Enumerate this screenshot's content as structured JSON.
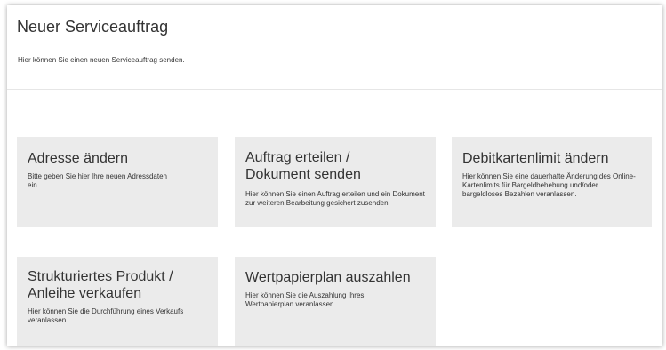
{
  "header": {
    "title": "Neuer Serviceauftrag",
    "subtitle": "Hier können Sie einen neuen Serviceauftrag senden."
  },
  "tiles": [
    {
      "title": "Adresse ändern",
      "description": "Bitte geben Sie hier Ihre neuen Adressdaten ein."
    },
    {
      "title": "Auftrag erteilen / Dokument senden",
      "description": "Hier können Sie einen Auftrag erteilen und ein Dokument zur weiteren Bearbeitung gesichert zusenden."
    },
    {
      "title": "Debitkartenlimit ändern",
      "description": "Hier können Sie eine dauerhafte Änderung des Online-Kartenlimits für Bargeldbehebung und/oder bargeldloses Bezahlen veranlassen."
    },
    {
      "title": "Strukturiertes Produkt / Anleihe verkaufen",
      "description": "Hier können Sie die Durchführung eines Verkaufs veranlassen."
    },
    {
      "title": "Wertpapierplan auszahlen",
      "description": "Hier können Sie die Auszahlung Ihres Wertpapierplan veranlassen."
    }
  ]
}
